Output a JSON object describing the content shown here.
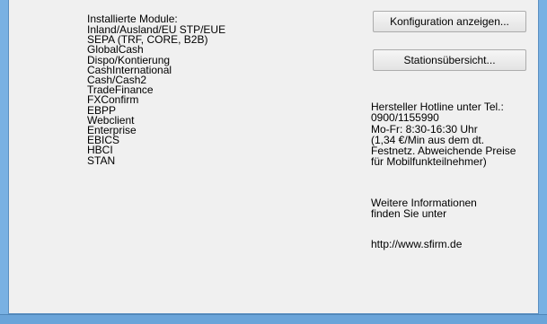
{
  "modules": {
    "heading": "Installierte Module:",
    "items": [
      "Inland/Ausland/EU STP/EUE",
      "SEPA (TRF, CORE, B2B)",
      "GlobalCash",
      "Dispo/Kontierung",
      "CashInternational",
      "Cash/Cash2",
      "TradeFinance",
      "FXConfirm",
      "EBPP",
      "Webclient",
      "Enterprise",
      "EBICS",
      "HBCI",
      "STAN"
    ]
  },
  "buttons": {
    "config_label": "Konfiguration anzeigen...",
    "station_label": "Stationsübersicht..."
  },
  "info": {
    "hotline": "Hersteller Hotline unter Tel.:\n0900/1155990\nMo-Fr: 8:30-16:30 Uhr\n(1,34 €/Min aus dem dt.\nFestnetz. Abweichende Preise\nfür Mobilfunkteilnehmer)",
    "more_info": "Weitere Informationen\nfinden Sie unter",
    "url": "http://www.sfirm.de"
  },
  "colors": {
    "window_frame": "#79b1e3",
    "client_background": "#f0f0f0",
    "button_border": "#acacac"
  }
}
